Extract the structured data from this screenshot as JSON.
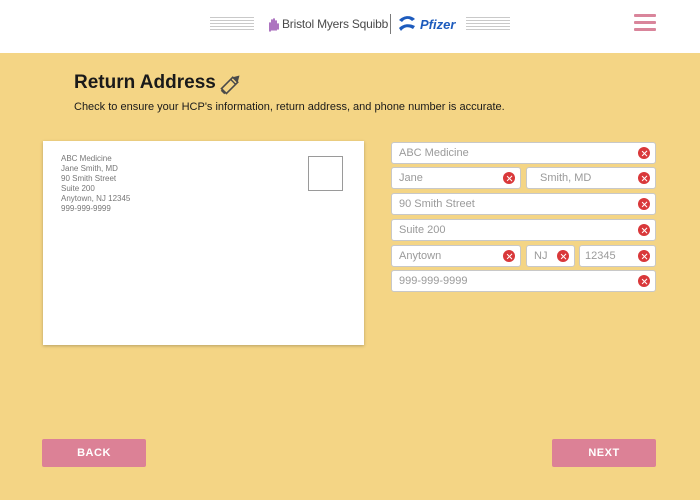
{
  "header": {
    "brand_bms": "Bristol Myers Squibb",
    "brand_pfizer": "Pfizer"
  },
  "main": {
    "title": "Return Address",
    "instructions": "Check to ensure your HCP's information, return address, and phone number is accurate."
  },
  "envelope": {
    "lines": [
      "ABC Medicine",
      "Jane Smith, MD",
      "90 Smith Street",
      "Suite 200",
      "Anytown, NJ 12345",
      "999-999-9999"
    ]
  },
  "form": {
    "practice": "ABC Medicine",
    "first_name": "Jane",
    "last_name": "Smith, MD",
    "street": "90 Smith Street",
    "suite": "Suite 200",
    "city": "Anytown",
    "state": "NJ",
    "zip": "12345",
    "phone": "999-999-9999"
  },
  "footer": {
    "back_label": "BACK",
    "next_label": "NEXT"
  },
  "colors": {
    "background": "#f4d585",
    "button": "#dc8196",
    "menu_icon": "#d9859b",
    "clear_icon": "#d9383a",
    "pfizer_blue": "#1d5bbd"
  },
  "icons": {
    "menu": "hamburger-menu-icon",
    "edit": "pencil-icon",
    "clear": "clear-x-icon"
  }
}
